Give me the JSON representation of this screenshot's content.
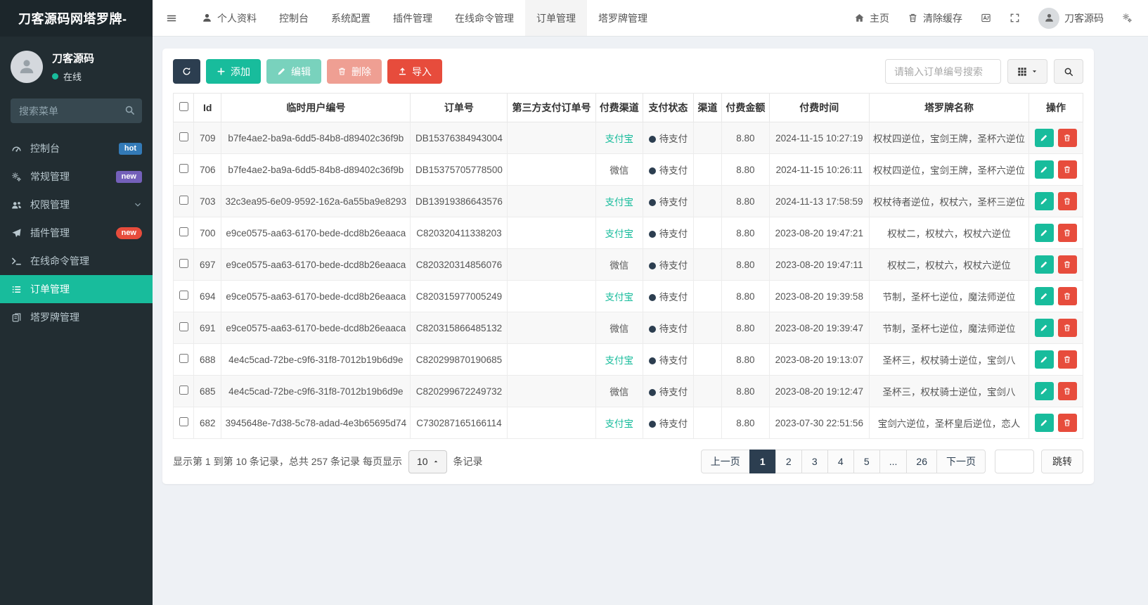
{
  "app": {
    "brand": "刀客源码网塔罗牌-"
  },
  "sidebar": {
    "user": {
      "name": "刀客源码",
      "status": "在线"
    },
    "search_placeholder": "搜索菜单",
    "items": [
      {
        "label": "控制台",
        "icon": "gauge",
        "badge": {
          "text": "hot",
          "color": "#337ab7",
          "pill": false
        }
      },
      {
        "label": "常规管理",
        "icon": "cogs",
        "badge": {
          "text": "new",
          "color": "#7460ba",
          "pill": false
        }
      },
      {
        "label": "权限管理",
        "icon": "users",
        "chevron": true
      },
      {
        "label": "插件管理",
        "icon": "send",
        "badge": {
          "text": "new",
          "color": "#e74c3c",
          "pill": true
        }
      },
      {
        "label": "在线命令管理",
        "icon": "terminal"
      },
      {
        "label": "订单管理",
        "icon": "list",
        "active": true
      },
      {
        "label": "塔罗牌管理",
        "icon": "tarot"
      }
    ]
  },
  "topnav": {
    "tabs": [
      {
        "label": "个人资料",
        "icon": "user"
      },
      {
        "label": "控制台"
      },
      {
        "label": "系统配置"
      },
      {
        "label": "插件管理"
      },
      {
        "label": "在线命令管理"
      },
      {
        "label": "订单管理",
        "active": true
      },
      {
        "label": "塔罗牌管理"
      }
    ],
    "home_label": "主页",
    "clear_cache_label": "清除缓存",
    "username": "刀客源码"
  },
  "toolbar": {
    "add": "添加",
    "edit": "编辑",
    "delete": "删除",
    "import": "导入",
    "search_placeholder": "请输入订单编号搜索"
  },
  "table": {
    "columns": [
      "Id",
      "临时用户编号",
      "订单号",
      "第三方支付订单号",
      "付费渠道",
      "支付状态",
      "渠道",
      "付费金额",
      "付费时间",
      "塔罗牌名称",
      "操作"
    ],
    "channel_highlight": "支付宝",
    "rows": [
      {
        "id": "709",
        "user_no": "b7fe4ae2-ba9a-6dd5-84b8-d89402c36f9b",
        "order_no": "DB15376384943004",
        "third_no": "",
        "channel": "支付宝",
        "status": "待支付",
        "qudao": "",
        "amount": "8.80",
        "time": "2024-11-15 10:27:19",
        "tarot": "权杖四逆位，宝剑王牌，圣杯六逆位"
      },
      {
        "id": "706",
        "user_no": "b7fe4ae2-ba9a-6dd5-84b8-d89402c36f9b",
        "order_no": "DB15375705778500",
        "third_no": "",
        "channel": "微信",
        "status": "待支付",
        "qudao": "",
        "amount": "8.80",
        "time": "2024-11-15 10:26:11",
        "tarot": "权杖四逆位，宝剑王牌，圣杯六逆位"
      },
      {
        "id": "703",
        "user_no": "32c3ea95-6e09-9592-162a-6a55ba9e8293",
        "order_no": "DB13919386643576",
        "third_no": "",
        "channel": "支付宝",
        "status": "待支付",
        "qudao": "",
        "amount": "8.80",
        "time": "2024-11-13 17:58:59",
        "tarot": "权杖待者逆位，权杖六，圣杯三逆位"
      },
      {
        "id": "700",
        "user_no": "e9ce0575-aa63-6170-bede-dcd8b26eaaca",
        "order_no": "C820320411338203",
        "third_no": "",
        "channel": "支付宝",
        "status": "待支付",
        "qudao": "",
        "amount": "8.80",
        "time": "2023-08-20 19:47:21",
        "tarot": "权杖二，权杖六，权杖六逆位"
      },
      {
        "id": "697",
        "user_no": "e9ce0575-aa63-6170-bede-dcd8b26eaaca",
        "order_no": "C820320314856076",
        "third_no": "",
        "channel": "微信",
        "status": "待支付",
        "qudao": "",
        "amount": "8.80",
        "time": "2023-08-20 19:47:11",
        "tarot": "权杖二，权杖六，权杖六逆位"
      },
      {
        "id": "694",
        "user_no": "e9ce0575-aa63-6170-bede-dcd8b26eaaca",
        "order_no": "C820315977005249",
        "third_no": "",
        "channel": "支付宝",
        "status": "待支付",
        "qudao": "",
        "amount": "8.80",
        "time": "2023-08-20 19:39:58",
        "tarot": "节制，圣杯七逆位，魔法师逆位"
      },
      {
        "id": "691",
        "user_no": "e9ce0575-aa63-6170-bede-dcd8b26eaaca",
        "order_no": "C820315866485132",
        "third_no": "",
        "channel": "微信",
        "status": "待支付",
        "qudao": "",
        "amount": "8.80",
        "time": "2023-08-20 19:39:47",
        "tarot": "节制，圣杯七逆位，魔法师逆位"
      },
      {
        "id": "688",
        "user_no": "4e4c5cad-72be-c9f6-31f8-7012b19b6d9e",
        "order_no": "C820299870190685",
        "third_no": "",
        "channel": "支付宝",
        "status": "待支付",
        "qudao": "",
        "amount": "8.80",
        "time": "2023-08-20 19:13:07",
        "tarot": "圣杯三，权杖骑士逆位，宝剑八"
      },
      {
        "id": "685",
        "user_no": "4e4c5cad-72be-c9f6-31f8-7012b19b6d9e",
        "order_no": "C820299672249732",
        "third_no": "",
        "channel": "微信",
        "status": "待支付",
        "qudao": "",
        "amount": "8.80",
        "time": "2023-08-20 19:12:47",
        "tarot": "圣杯三，权杖骑士逆位，宝剑八"
      },
      {
        "id": "682",
        "user_no": "3945648e-7d38-5c78-adad-4e3b65695d74",
        "order_no": "C730287165166114",
        "third_no": "",
        "channel": "支付宝",
        "status": "待支付",
        "qudao": "",
        "amount": "8.80",
        "time": "2023-07-30 22:51:56",
        "tarot": "宝剑六逆位，圣杯皇后逆位，恋人"
      }
    ]
  },
  "pagination": {
    "summary_prefix": "显示第 1 到第 10 条记录，总共 257 条记录 每页显示",
    "page_size": "10",
    "summary_suffix": "条记录",
    "pages": [
      {
        "label": "上一页"
      },
      {
        "label": "1",
        "active": true
      },
      {
        "label": "2"
      },
      {
        "label": "3"
      },
      {
        "label": "4"
      },
      {
        "label": "5"
      },
      {
        "label": "..."
      },
      {
        "label": "26"
      },
      {
        "label": "下一页"
      }
    ],
    "jump_label": "跳转"
  },
  "colors": {
    "accent": "#18bc9c",
    "dark": "#2c3e50",
    "danger": "#e74c3c",
    "badge_hot": "#337ab7",
    "badge_new_purple": "#7460ba",
    "badge_new_red": "#e74c3c"
  }
}
